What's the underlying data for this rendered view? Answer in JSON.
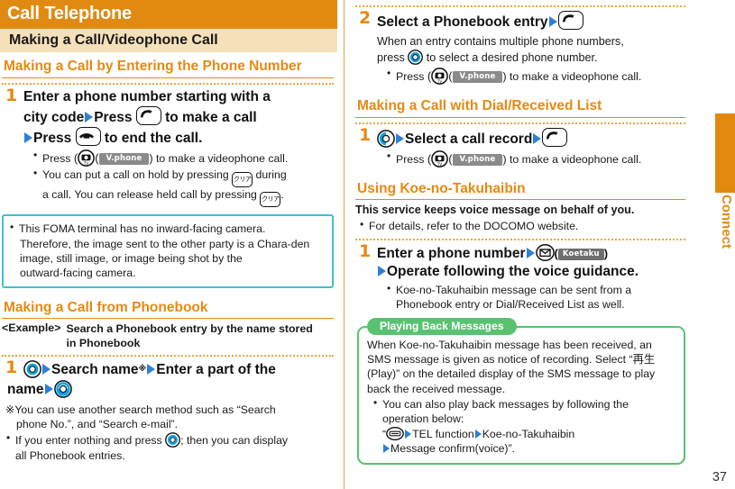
{
  "page": {
    "number": "37",
    "side_tab_label": "Connect"
  },
  "colors": {
    "orange": "#e18a12",
    "cream": "#f6e0ba",
    "cyan": "#3fc0d0",
    "green": "#59c271",
    "arrow_blue": "#2f7fd6",
    "softkey_grey": "#8a8a8a"
  },
  "left": {
    "title": "Call Telephone",
    "subtitle": "Making a Call/Videophone Call",
    "section1_heading": "Making a Call by Entering the Phone Number",
    "step1": {
      "num": "1",
      "line1": "Enter a phone number starting with a",
      "line2a": "city code",
      "line2b": "Press",
      "line2c": "to make a call",
      "line3a": "Press",
      "line3b": "to end the call.",
      "bullet1a": "Press",
      "bullet1_softkey": "V.phone",
      "bullet1b": ") to make a videophone call.",
      "bullet2a": "You can put a call on hold by pressing",
      "bullet2b": "during",
      "bullet2c": "a call. You can release held call by pressing",
      "bullet2d": "."
    },
    "note_cyan": [
      "This FOMA terminal has no inward-facing camera.",
      "Therefore, the image sent to the other party is a Chara-den",
      "image, still image, or image being shot by the",
      "outward-facing camera."
    ],
    "section2_heading": "Making a Call from Phonebook",
    "example_label": "<Example>",
    "example_text_l1": "Search a Phonebook entry by the name stored",
    "example_text_l2": "in Phonebook",
    "step2": {
      "num": "1",
      "t1": "Search name",
      "mark": "※",
      "t2": "Enter a part of the",
      "t3": "name"
    },
    "footnote_marker": "※",
    "footnote_l1": "You can use another search method such as “Search",
    "footnote_l2": "phone No.”, and “Search e-mail”.",
    "bullet_last_a": "If you enter nothing and press",
    "bullet_last_b": "; then you can display",
    "bullet_last_c": "all Phonebook entries."
  },
  "right": {
    "step2": {
      "num": "2",
      "head": "Select a Phonebook entry",
      "body_l1": "When an entry contains multiple phone numbers,",
      "body_l2a": "press",
      "body_l2b": "to select a desired phone number.",
      "bullet_a": "Press",
      "bullet_softkey": "V.phone",
      "bullet_b": ") to make a videophone call."
    },
    "section_dial_heading": "Making a Call with Dial/Received List",
    "step_dial": {
      "num": "1",
      "head": "Select a call record",
      "bullet_a": "Press",
      "bullet_softkey": "V.phone",
      "bullet_b": ") to make a videophone call."
    },
    "section_koe_heading": "Using Koe-no-Takuhaibin",
    "koe_lead": "This service keeps voice message on behalf of you.",
    "koe_bullet": "For details, refer to the DOCOMO website.",
    "step_koe": {
      "num": "1",
      "head_a": "Enter a phone number",
      "softkey": "Koetaku",
      "head_b": "Operate following the voice guidance.",
      "bullet_l1": "Koe-no-Takuhaibin message can be sent from a",
      "bullet_l2": "Phonebook entry or Dial/Received List as well."
    },
    "green_box": {
      "pill": "Playing Back Messages",
      "l1": "When Koe-no-Takuhaibin message has been received, an",
      "l2": "SMS message is given as notice of recording. Select “再生",
      "l3": "(Play)” on the detailed display of the SMS message to play",
      "l4": "back the received message.",
      "b1": "You can also play back messages by following the",
      "b2": "operation below:",
      "b3_open": "“",
      "b3_a": "TEL function",
      "b3_b": "Koe-no-Takuhaibin",
      "b4": "Message confirm(voice)”."
    }
  },
  "icons": {
    "call_key": "call-key-icon",
    "end_key": "end-key-icon",
    "clear_key": "clear-key-icon",
    "clear_key_label": "クリア",
    "camera_key": "camera-tv-key-icon",
    "nav_center": "nav-center-key-icon",
    "nav_down": "nav-down-key-icon",
    "nav_left_right": "nav-left-right-key-icon",
    "nav_left": "nav-left-key-icon",
    "envelope_key": "mail-key-icon",
    "menu_key": "menu-key-icon"
  }
}
